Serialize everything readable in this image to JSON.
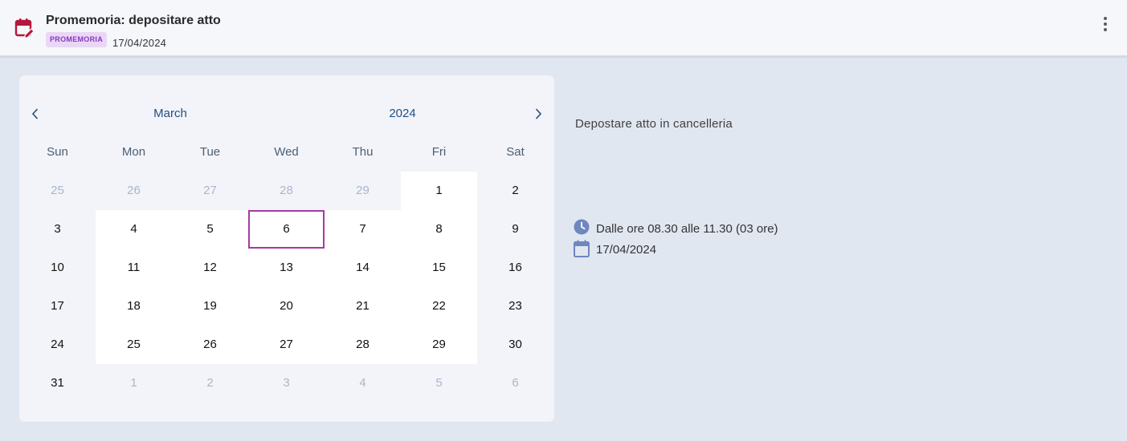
{
  "header": {
    "title": "Promemoria: depositare atto",
    "badge": "PROMEMORIA",
    "date": "17/04/2024",
    "icon": "calendar-edit-icon",
    "accent_color": "#b5163b"
  },
  "calendar": {
    "month": "March",
    "year": "2024",
    "weekdays": [
      "Sun",
      "Mon",
      "Tue",
      "Wed",
      "Thu",
      "Fri",
      "Sat"
    ],
    "weeks": [
      [
        {
          "d": "25",
          "out": true
        },
        {
          "d": "26",
          "out": true
        },
        {
          "d": "27",
          "out": true
        },
        {
          "d": "28",
          "out": true
        },
        {
          "d": "29",
          "out": true
        },
        {
          "d": "1"
        },
        {
          "d": "2"
        }
      ],
      [
        {
          "d": "3"
        },
        {
          "d": "4"
        },
        {
          "d": "5"
        },
        {
          "d": "6",
          "today": true
        },
        {
          "d": "7"
        },
        {
          "d": "8"
        },
        {
          "d": "9"
        }
      ],
      [
        {
          "d": "10"
        },
        {
          "d": "11"
        },
        {
          "d": "12"
        },
        {
          "d": "13"
        },
        {
          "d": "14"
        },
        {
          "d": "15"
        },
        {
          "d": "16"
        }
      ],
      [
        {
          "d": "17"
        },
        {
          "d": "18"
        },
        {
          "d": "19"
        },
        {
          "d": "20"
        },
        {
          "d": "21"
        },
        {
          "d": "22"
        },
        {
          "d": "23"
        }
      ],
      [
        {
          "d": "24"
        },
        {
          "d": "25"
        },
        {
          "d": "26"
        },
        {
          "d": "27"
        },
        {
          "d": "28"
        },
        {
          "d": "29"
        },
        {
          "d": "30"
        }
      ],
      [
        {
          "d": "31"
        },
        {
          "d": "1",
          "out": true
        },
        {
          "d": "2",
          "out": true
        },
        {
          "d": "3",
          "out": true
        },
        {
          "d": "4",
          "out": true
        },
        {
          "d": "5",
          "out": true
        },
        {
          "d": "6",
          "out": true
        }
      ]
    ],
    "today_color": "#a63aa2"
  },
  "detail": {
    "description": "Depostare atto in cancelleria",
    "time": "Dalle ore 08.30 alle 11.30 (03 ore)",
    "date": "17/04/2024",
    "icon_color": "#6f86bf"
  }
}
